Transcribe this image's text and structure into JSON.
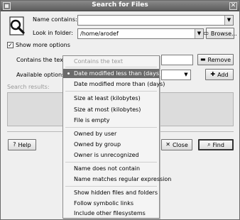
{
  "window": {
    "title": "Search for Files"
  },
  "form": {
    "name_label": "Name contains:",
    "name_value": "",
    "folder_label": "Look in folder:",
    "folder_value": "/home/arodef",
    "browse_label": "Browse...",
    "show_more_label": "Show more options",
    "show_more_checked": true,
    "contains_text_label": "Contains the text:",
    "contains_text_value": "",
    "remove_label": "Remove",
    "available_label": "Available options:",
    "add_label": "Add",
    "results_label": "Search results:"
  },
  "footer": {
    "help_label": "Help",
    "close_label": "Close",
    "find_label": "Find"
  },
  "menu": {
    "items": [
      {
        "label": "Contains the text",
        "state": "disabled"
      },
      {
        "label": "Date modified less than (days)",
        "state": "selected"
      },
      {
        "label": "Date modified more than (days)",
        "state": "normal"
      },
      {
        "label": "Size at least (kilobytes)",
        "state": "normal"
      },
      {
        "label": "Size at most (kilobytes)",
        "state": "normal"
      },
      {
        "label": "File is empty",
        "state": "normal"
      },
      {
        "label": "Owned by user",
        "state": "normal"
      },
      {
        "label": "Owned by group",
        "state": "normal"
      },
      {
        "label": "Owner is unrecognized",
        "state": "normal"
      },
      {
        "label": "Name does not contain",
        "state": "normal"
      },
      {
        "label": "Name matches regular expression",
        "state": "normal"
      },
      {
        "label": "Show hidden files and folders",
        "state": "normal"
      },
      {
        "label": "Follow symbolic links",
        "state": "normal"
      },
      {
        "label": "Include other filesystems",
        "state": "normal"
      }
    ]
  }
}
